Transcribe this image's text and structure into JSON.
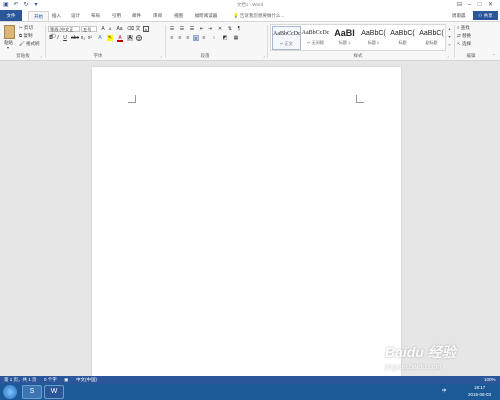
{
  "window": {
    "title": "文档1 - Word",
    "minimize_icon": "minimize-icon",
    "restore_icon": "restore-icon",
    "close_icon": "close-icon"
  },
  "quick_access": {
    "save_icon": "save-icon",
    "undo_icon": "undo-icon",
    "redo_icon": "redo-icon"
  },
  "tabs": [
    {
      "label": "文件"
    },
    {
      "label": "开始"
    },
    {
      "label": "插入"
    },
    {
      "label": "设计"
    },
    {
      "label": "布局"
    },
    {
      "label": "引用"
    },
    {
      "label": "邮件"
    },
    {
      "label": "审阅"
    },
    {
      "label": "视图"
    },
    {
      "label": "福昕阅读器"
    }
  ],
  "tell_me": "告诉我您想要做什么...",
  "sign_in": "周雨晨",
  "share": "共享",
  "clipboard": {
    "paste": "粘贴",
    "cut": "剪切",
    "copy": "复制",
    "format_painter": "格式刷",
    "group_label": "剪贴板"
  },
  "font": {
    "font_name": "等线 (中文正文)",
    "font_size": "五号",
    "group_label": "字体"
  },
  "paragraph": {
    "group_label": "段落"
  },
  "styles": {
    "group_label": "样式",
    "items": [
      {
        "preview": "AaBbCcDc",
        "name": "↵ 正文"
      },
      {
        "preview": "AaBbCcDc",
        "name": "↵ 无间隔"
      },
      {
        "preview": "AaBl",
        "name": "标题 1"
      },
      {
        "preview": "AaBbC(",
        "name": "标题 2"
      },
      {
        "preview": "AaBbC(",
        "name": "标题"
      },
      {
        "preview": "AaBbC(",
        "name": "副标题"
      }
    ]
  },
  "editing": {
    "find": "查找",
    "replace": "替换",
    "select": "选择",
    "group_label": "编辑"
  },
  "status": {
    "page": "第 1 页，共 1 页",
    "words": "0 个字",
    "language": "中文(中国)",
    "zoom": "100%"
  },
  "tray": {
    "time": "18:17",
    "date": "2016-08-03"
  },
  "watermark": {
    "brand": "Baidu 经验",
    "url": "jingyan.baidu.com"
  }
}
